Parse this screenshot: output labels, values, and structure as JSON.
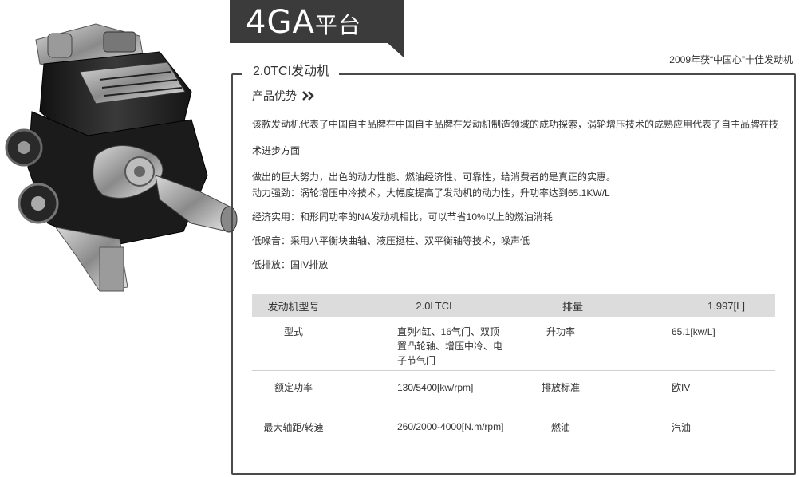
{
  "platform": {
    "title_main": "4GA",
    "title_sub": "平台"
  },
  "award": "2009年获“中国心”十佳发动机",
  "engine_name": "2.0TCI发动机",
  "section_title": "产品优势",
  "description": [
    "该款发动机代表了中国自主品牌在中国自主品牌在发动机制造领域的成功探索，涡轮增压技术的成熟应用代表了自主品牌在技术进步方面",
    "做出的巨大努力，出色的动力性能、燃油经济性、可靠性，给消费者的是真正的实惠。"
  ],
  "features": [
    "动力强劲：涡轮增压中冷技术，大幅度提高了发动机的动力性，升功率达到65.1KW/L",
    "经济实用：和形同功率的NA发动机相比，可以节省10%以上的燃油消耗",
    "低噪音：采用八平衡块曲轴、液压挺柱、双平衡轴等技术，噪声低",
    "低排放：国IV排放"
  ],
  "spec_table": {
    "header": [
      "发动机型号",
      "2.0LTCI",
      "排量",
      "1.997[L]"
    ],
    "rows": [
      [
        "型式",
        "直列4缸、16气门、双顶置凸轮轴、增压中冷、电子节气门",
        "升功率",
        "65.1[kw/L]"
      ],
      [
        "额定功率",
        "130/5400[kw/rpm]",
        "排放标准",
        "欧IV"
      ],
      [
        "最大轴距/转速",
        "260/2000-4000[N.m/rpm]",
        "燃油",
        "汽油"
      ]
    ]
  },
  "colors": {
    "banner": "#3b3b3b",
    "panel_border": "#4a4a4a",
    "table_header": "#dcdcdc"
  }
}
